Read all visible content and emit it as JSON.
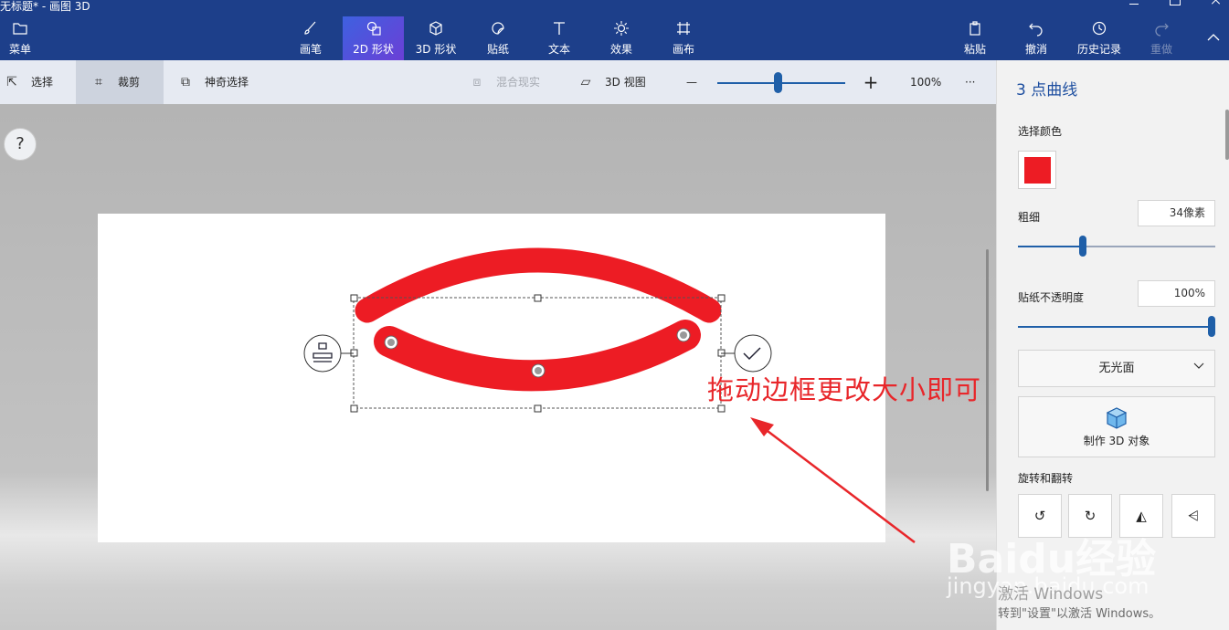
{
  "window": {
    "title": "无标题* - 画图 3D"
  },
  "ribbon": {
    "menu_label": "菜单",
    "tools": [
      {
        "label": "画笔",
        "icon": "brush-icon"
      },
      {
        "label": "2D 形状",
        "icon": "2d-shapes-icon",
        "active": true
      },
      {
        "label": "3D 形状",
        "icon": "3d-shapes-icon"
      },
      {
        "label": "贴纸",
        "icon": "sticker-icon"
      },
      {
        "label": "文本",
        "icon": "text-icon"
      },
      {
        "label": "效果",
        "icon": "effects-icon"
      },
      {
        "label": "画布",
        "icon": "canvas-icon"
      }
    ],
    "paste_label": "粘贴",
    "undo_label": "撤消",
    "history_label": "历史记录",
    "redo_label": "重做"
  },
  "subbar": {
    "select_label": "选择",
    "crop_label": "裁剪",
    "magic_select_label": "神奇选择",
    "mixed_reality_label": "混合现实",
    "view3d_label": "3D 视图",
    "zoom_out": "—",
    "zoom_in": "+",
    "zoom_value": "100%",
    "more": "···",
    "zoom_level": 0.47
  },
  "workspace": {
    "help": "?",
    "annotation": "拖动边框更改大小即可"
  },
  "panel": {
    "title": "3 点曲线",
    "color_label": "选择颜色",
    "color": "#ed1c24",
    "thickness_label": "粗细",
    "thickness_value": "34像素",
    "thickness_level": 0.33,
    "opacity_label": "贴纸不透明度",
    "opacity_value": "100%",
    "opacity_level": 1.0,
    "finish_value": "无光面",
    "make3d_label": "制作 3D 对象",
    "rotate_label": "旋转和翻转"
  },
  "watermark": {
    "logo": "Baidu经验",
    "url": "jingyan.baidu.com",
    "activate_title": "激活 Windows",
    "activate_hint": "转到\"设置\"以激活 Windows。"
  }
}
